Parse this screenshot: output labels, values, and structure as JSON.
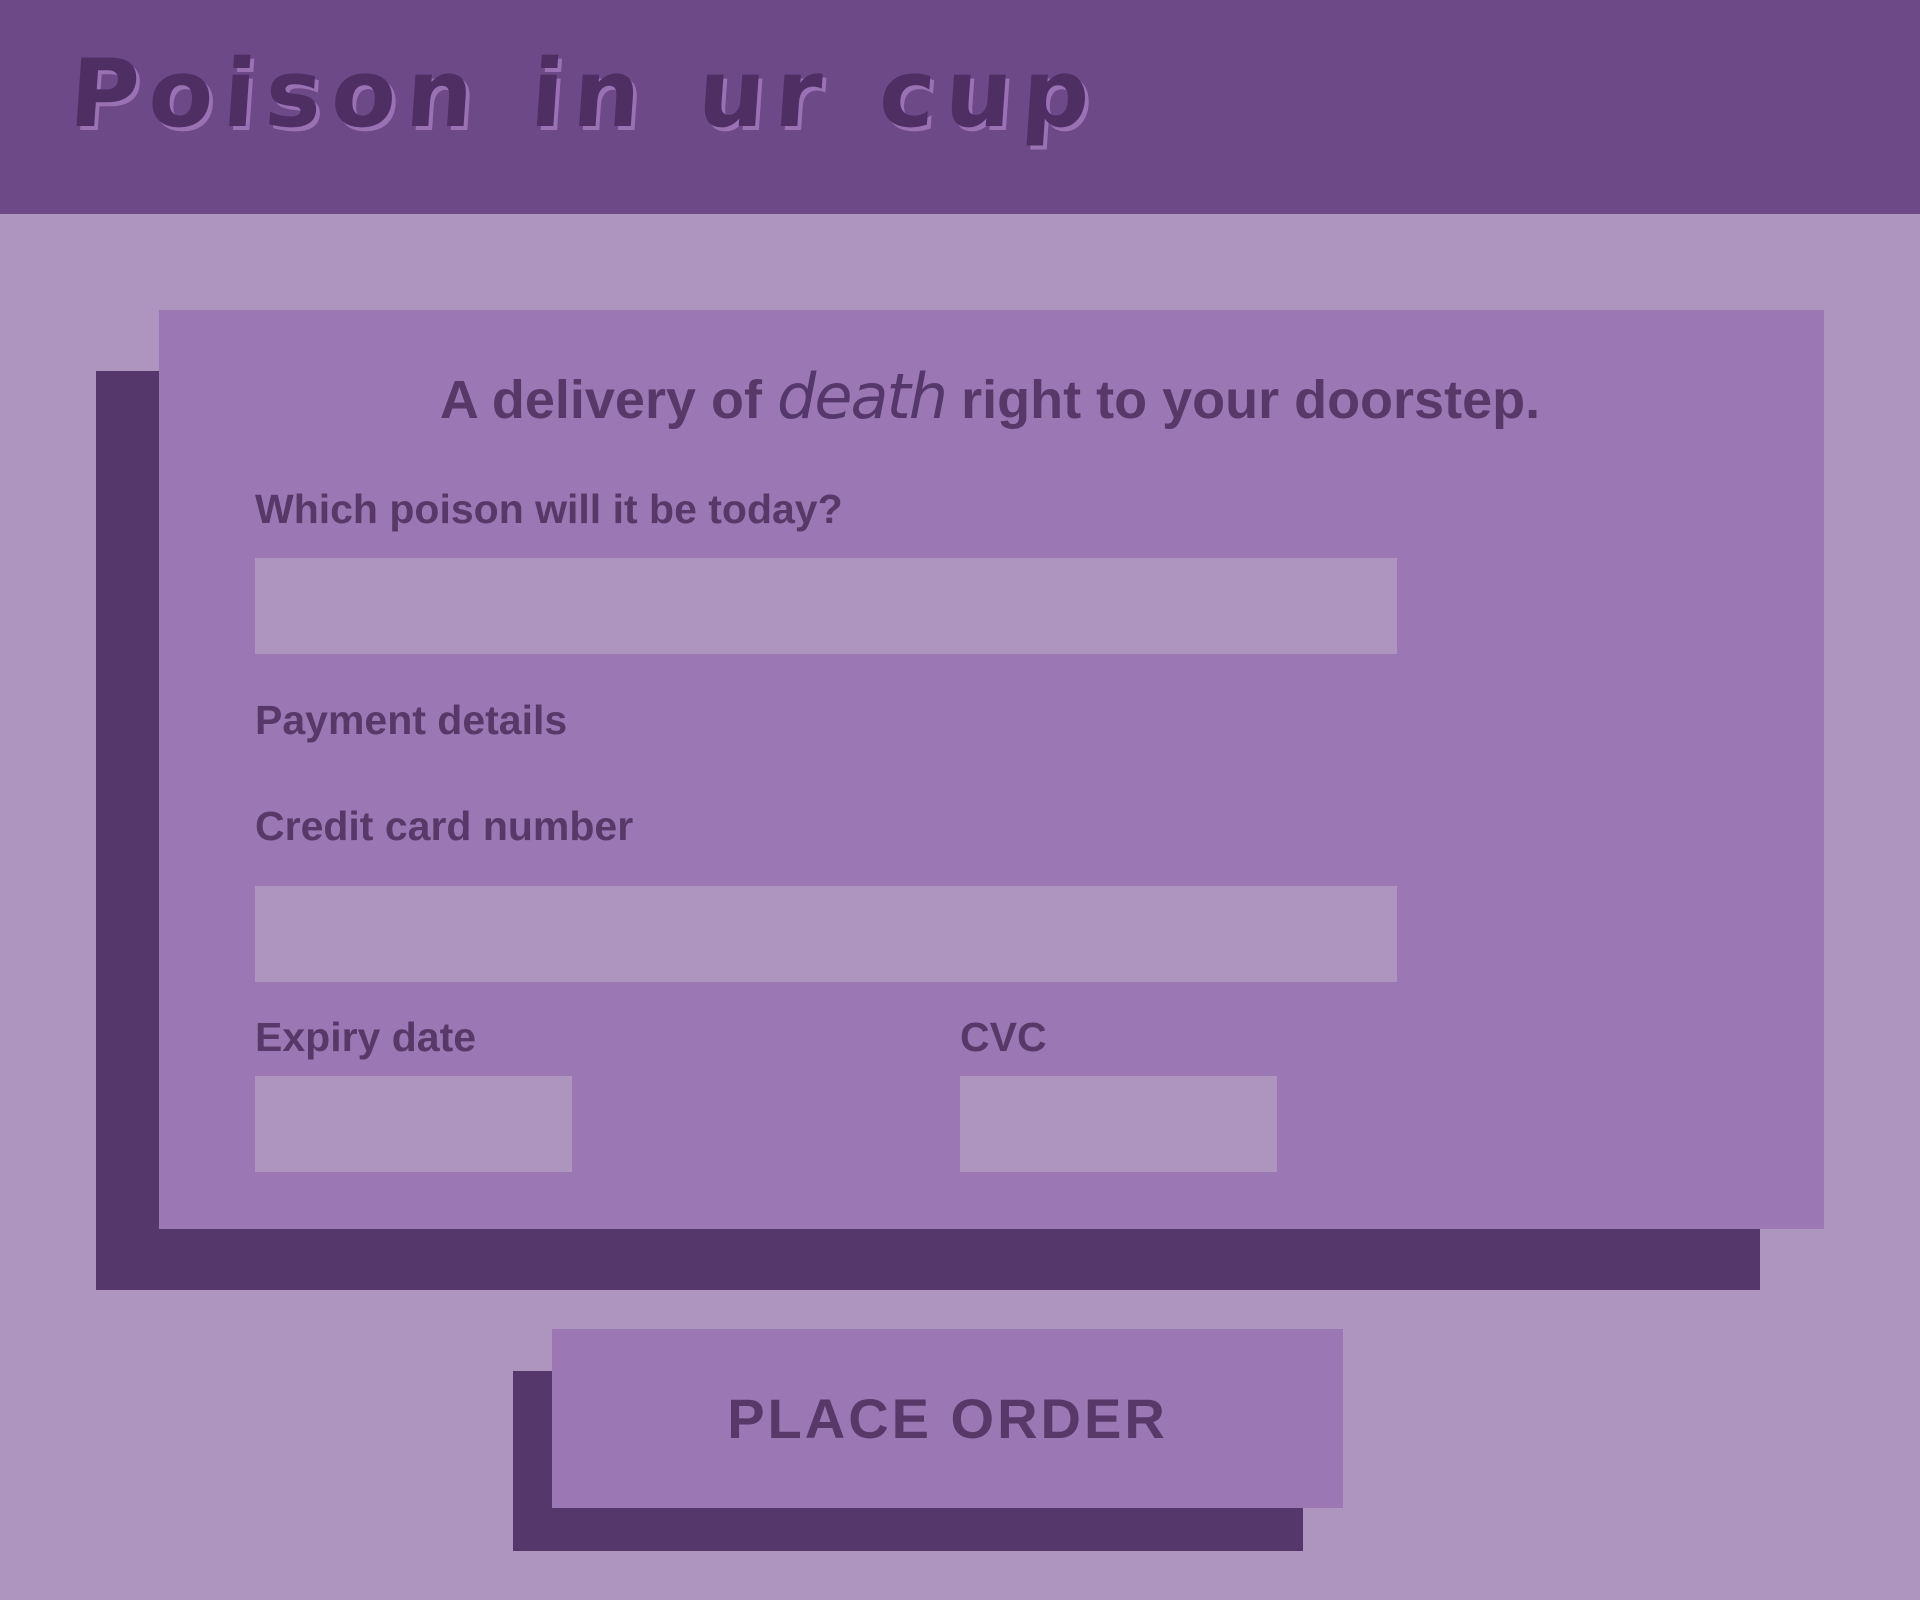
{
  "header": {
    "logo_words": [
      "Poison",
      "in",
      "ur",
      "cup"
    ]
  },
  "form": {
    "headline_before": "A delivery of",
    "headline_emphasis": "death",
    "headline_after": "right to your doorstep.",
    "poison_label": "Which poison will it be today?",
    "poison_value": "",
    "payment_heading": "Payment details",
    "card_number_label": "Credit card number",
    "card_number_value": "",
    "expiry_label": "Expiry date",
    "expiry_value": "",
    "cvc_label": "CVC",
    "cvc_value": ""
  },
  "actions": {
    "place_order_label": "PLACE ORDER"
  },
  "colors": {
    "page_background": "#ae95bf",
    "header_background": "#6d4987",
    "card_background": "#9b78b3",
    "shadow": "#56376b",
    "text": "#583869",
    "input_background": "#ae95bf"
  }
}
